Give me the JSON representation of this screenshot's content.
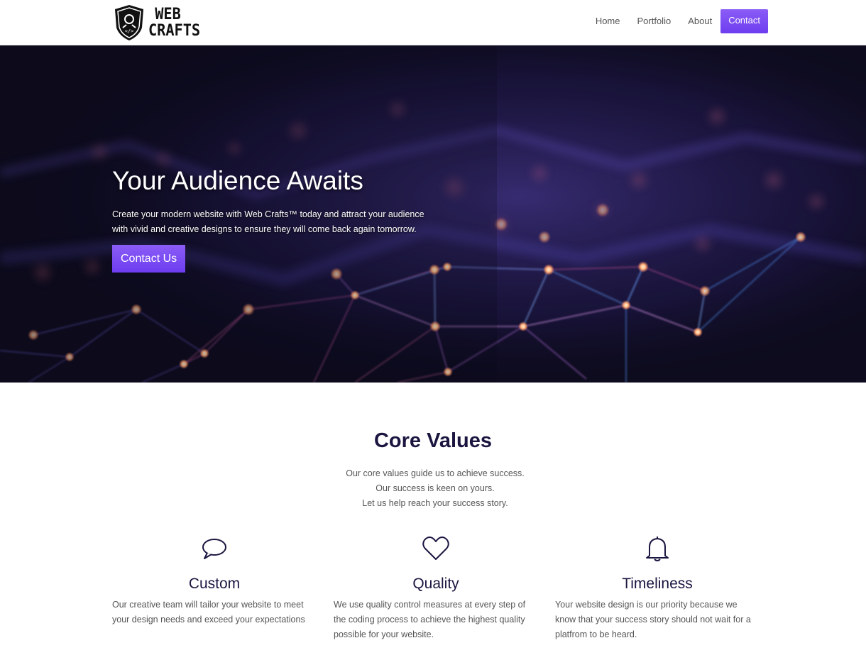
{
  "brand": {
    "name_line1": "WEB",
    "name_line2": "CRAFTS",
    "logo_icon": "shield-crest-icon"
  },
  "nav": {
    "items": [
      {
        "label": "Home"
      },
      {
        "label": "Portfolio"
      },
      {
        "label": "About"
      }
    ],
    "cta_label": "Contact"
  },
  "hero": {
    "title": "Your Audience Awaits",
    "subtitle": "Create your modern website with Web Crafts™ today and attract your audience with vivid and creative designs to ensure they will come back again tomorrow.",
    "button_label": "Contact Us",
    "background": "network-nodes-image"
  },
  "core_values": {
    "title": "Core Values",
    "lines": [
      "Our core values guide us to achieve success.",
      "Our success is keen on yours.",
      "Let us help reach your success story."
    ],
    "items": [
      {
        "icon": "speech-bubble-icon",
        "title": "Custom",
        "text": "Our creative team will tailor your website to meet your design needs and exceed your expectations"
      },
      {
        "icon": "heart-icon",
        "title": "Quality",
        "text": "We use quality control measures at every step of the coding process to achieve the highest quality possible for your website."
      },
      {
        "icon": "bell-icon",
        "title": "Timeliness",
        "text": "Your website design is our priority because we know that your success story should not wait for a platfrom to be heard."
      }
    ]
  },
  "colors": {
    "accent": "#7c4dff",
    "heading": "#1a1640",
    "body_text": "#555555",
    "hero_bg": "#0d0b1d"
  }
}
